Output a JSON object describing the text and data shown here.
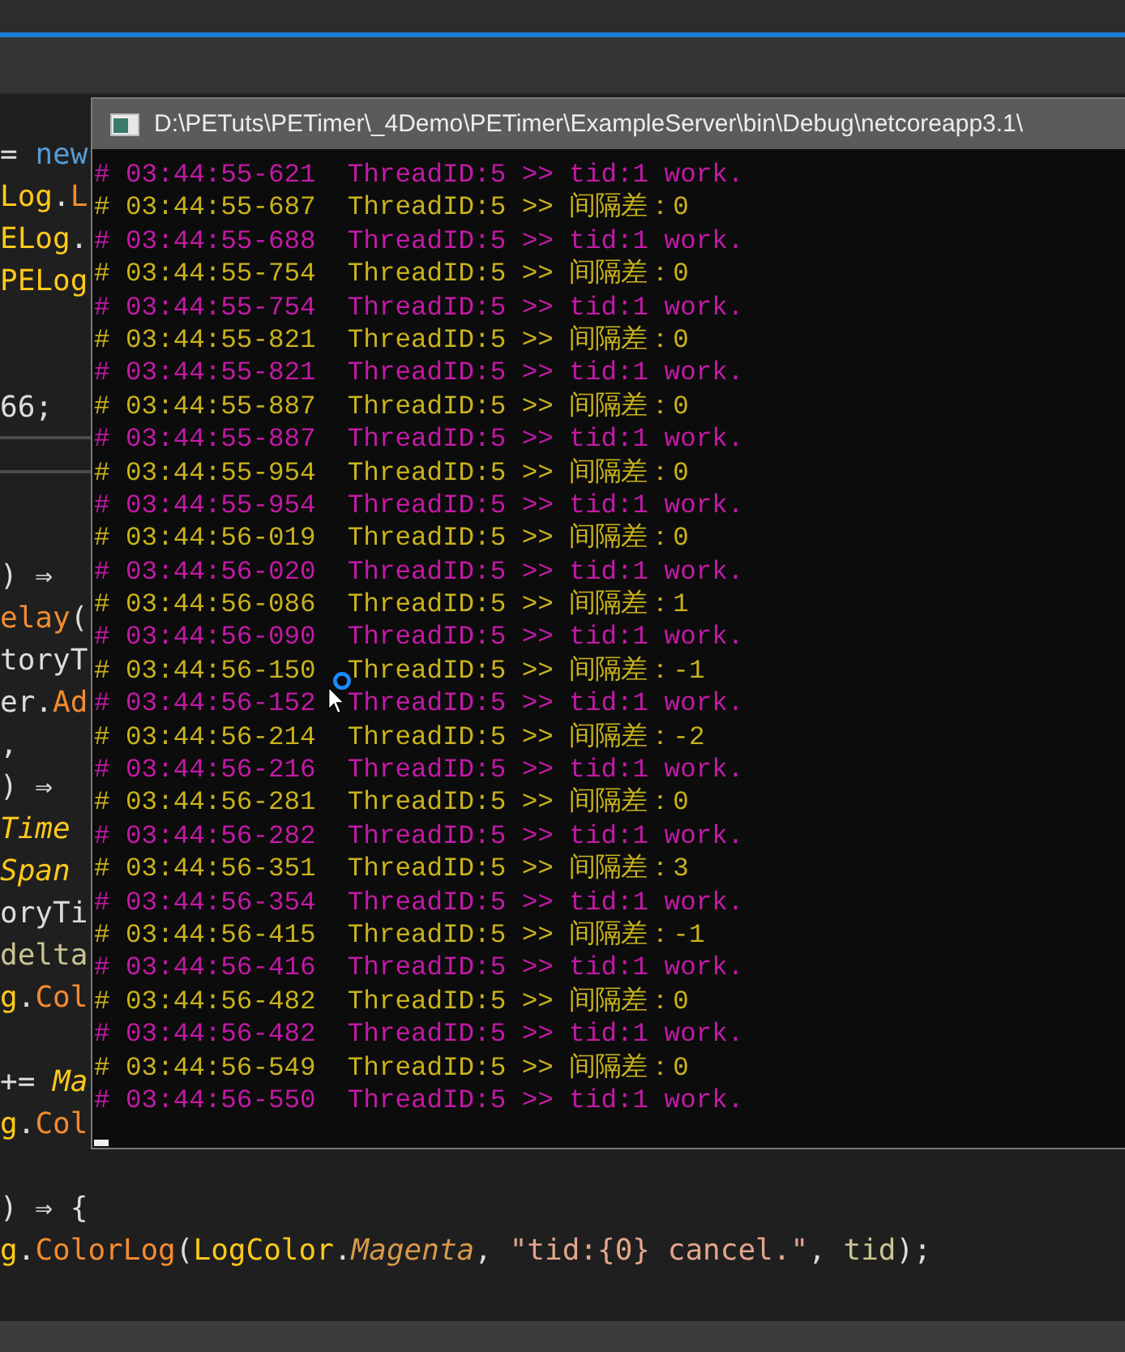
{
  "editor": {
    "blocks": [
      {
        "lines": [
          [
            {
              "text": "= ",
              "kind": "plain"
            },
            {
              "text": "new",
              "kind": "keyword"
            }
          ],
          [
            {
              "text": "Log",
              "kind": "type"
            },
            {
              "text": ".",
              "kind": "plain"
            },
            {
              "text": "L",
              "kind": "method"
            }
          ],
          [
            {
              "text": "ELog",
              "kind": "type"
            },
            {
              "text": ".",
              "kind": "plain"
            }
          ],
          [
            {
              "text": "PELog",
              "kind": "type"
            }
          ]
        ]
      },
      {
        "lines": [
          [
            {
              "text": "66;",
              "kind": "plain"
            }
          ]
        ]
      },
      {
        "lines": [
          [
            {
              "text": ") ⇒",
              "kind": "plain"
            }
          ],
          [
            {
              "text": "elay",
              "kind": "method"
            },
            {
              "text": "(",
              "kind": "plain"
            }
          ],
          [
            {
              "text": "toryT",
              "kind": "plain"
            }
          ],
          [
            {
              "text": "er.",
              "kind": "plain"
            },
            {
              "text": "Ad",
              "kind": "method"
            }
          ],
          [
            {
              "text": ",",
              "kind": "plain"
            }
          ],
          [
            {
              "text": ") ⇒",
              "kind": "plain"
            }
          ],
          [
            {
              "text": "Time",
              "kind": "italic-type"
            }
          ],
          [
            {
              "text": "Span",
              "kind": "italic-type"
            }
          ],
          [
            {
              "text": "oryTi",
              "kind": "plain"
            }
          ],
          [
            {
              "text": "delta",
              "kind": "param"
            }
          ],
          [
            {
              "text": "g",
              "kind": "type"
            },
            {
              "text": ".",
              "kind": "plain"
            },
            {
              "text": "Col",
              "kind": "method"
            }
          ]
        ]
      },
      {
        "lines": [
          [
            {
              "text": "+= ",
              "kind": "plain"
            },
            {
              "text": "Ma",
              "kind": "italic-type"
            }
          ],
          [
            {
              "text": "g",
              "kind": "type"
            },
            {
              "text": ".",
              "kind": "plain"
            },
            {
              "text": "Col",
              "kind": "method"
            }
          ]
        ]
      },
      {
        "lines": [
          [
            {
              "text": ") ⇒ {",
              "kind": "plain"
            }
          ],
          [
            {
              "text": "g",
              "kind": "type"
            },
            {
              "text": ".",
              "kind": "plain"
            },
            {
              "text": "ColorLog",
              "kind": "method"
            },
            {
              "text": "(",
              "kind": "plain"
            },
            {
              "text": "LogColor",
              "kind": "type"
            },
            {
              "text": ".",
              "kind": "plain"
            },
            {
              "text": "Magenta",
              "kind": "member"
            },
            {
              "text": ", ",
              "kind": "plain"
            },
            {
              "text": "\"tid:{0} cancel.\"",
              "kind": "string"
            },
            {
              "text": ", ",
              "kind": "plain"
            },
            {
              "text": "tid",
              "kind": "param"
            },
            {
              "text": ");",
              "kind": "plain"
            }
          ]
        ]
      }
    ]
  },
  "console": {
    "title": "D:\\PETuts\\PETimer\\_4Demo\\PETimer\\ExampleServer\\bin\\Debug\\netcoreapp3.1\\",
    "lines": [
      {
        "stamp": "# 03:44:55-621",
        "text": "ThreadID:5 >> tid:1 work.",
        "kind": "work"
      },
      {
        "stamp": "# 03:44:55-687",
        "text": "ThreadID:5 >> 间隔差：0",
        "kind": "diff"
      },
      {
        "stamp": "# 03:44:55-688",
        "text": "ThreadID:5 >> tid:1 work.",
        "kind": "work"
      },
      {
        "stamp": "# 03:44:55-754",
        "text": "ThreadID:5 >> 间隔差：0",
        "kind": "diff"
      },
      {
        "stamp": "# 03:44:55-754",
        "text": "ThreadID:5 >> tid:1 work.",
        "kind": "work"
      },
      {
        "stamp": "# 03:44:55-821",
        "text": "ThreadID:5 >> 间隔差：0",
        "kind": "diff"
      },
      {
        "stamp": "# 03:44:55-821",
        "text": "ThreadID:5 >> tid:1 work.",
        "kind": "work"
      },
      {
        "stamp": "# 03:44:55-887",
        "text": "ThreadID:5 >> 间隔差：0",
        "kind": "diff"
      },
      {
        "stamp": "# 03:44:55-887",
        "text": "ThreadID:5 >> tid:1 work.",
        "kind": "work"
      },
      {
        "stamp": "# 03:44:55-954",
        "text": "ThreadID:5 >> 间隔差：0",
        "kind": "diff"
      },
      {
        "stamp": "# 03:44:55-954",
        "text": "ThreadID:5 >> tid:1 work.",
        "kind": "work"
      },
      {
        "stamp": "# 03:44:56-019",
        "text": "ThreadID:5 >> 间隔差：0",
        "kind": "diff"
      },
      {
        "stamp": "# 03:44:56-020",
        "text": "ThreadID:5 >> tid:1 work.",
        "kind": "work"
      },
      {
        "stamp": "# 03:44:56-086",
        "text": "ThreadID:5 >> 间隔差：1",
        "kind": "diff"
      },
      {
        "stamp": "# 03:44:56-090",
        "text": "ThreadID:5 >> tid:1 work.",
        "kind": "work"
      },
      {
        "stamp": "# 03:44:56-150",
        "text": "ThreadID:5 >> 间隔差：-1",
        "kind": "diff"
      },
      {
        "stamp": "# 03:44:56-152",
        "text": "ThreadID:5 >> tid:1 work.",
        "kind": "work"
      },
      {
        "stamp": "# 03:44:56-214",
        "text": "ThreadID:5 >> 间隔差：-2",
        "kind": "diff"
      },
      {
        "stamp": "# 03:44:56-216",
        "text": "ThreadID:5 >> tid:1 work.",
        "kind": "work"
      },
      {
        "stamp": "# 03:44:56-281",
        "text": "ThreadID:5 >> 间隔差：0",
        "kind": "diff"
      },
      {
        "stamp": "# 03:44:56-282",
        "text": "ThreadID:5 >> tid:1 work.",
        "kind": "work"
      },
      {
        "stamp": "# 03:44:56-351",
        "text": "ThreadID:5 >> 间隔差：3",
        "kind": "diff"
      },
      {
        "stamp": "# 03:44:56-354",
        "text": "ThreadID:5 >> tid:1 work.",
        "kind": "work"
      },
      {
        "stamp": "# 03:44:56-415",
        "text": "ThreadID:5 >> 间隔差：-1",
        "kind": "diff"
      },
      {
        "stamp": "# 03:44:56-416",
        "text": "ThreadID:5 >> tid:1 work.",
        "kind": "work"
      },
      {
        "stamp": "# 03:44:56-482",
        "text": "ThreadID:5 >> 间隔差：0",
        "kind": "diff"
      },
      {
        "stamp": "# 03:44:56-482",
        "text": "ThreadID:5 >> tid:1 work.",
        "kind": "work"
      },
      {
        "stamp": "# 03:44:56-549",
        "text": "ThreadID:5 >> 间隔差：0",
        "kind": "diff"
      },
      {
        "stamp": "# 03:44:56-550",
        "text": "ThreadID:5 >> tid:1 work.",
        "kind": "work"
      }
    ]
  }
}
